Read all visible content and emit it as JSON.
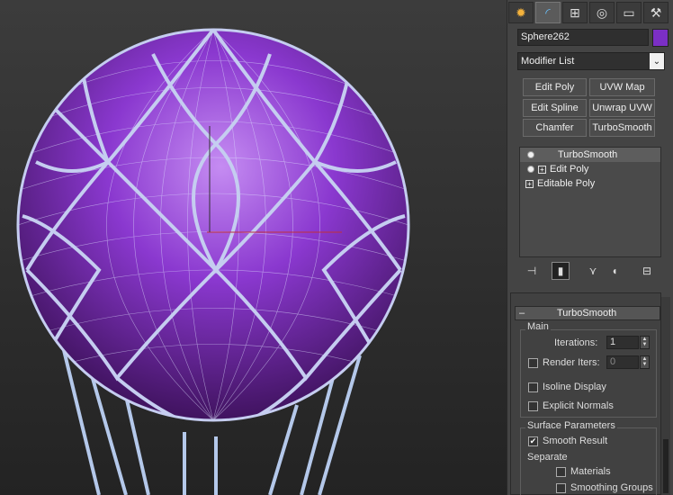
{
  "viewport": {
    "object_color": "#7b2fc5",
    "wire_color": "#c5cdf0",
    "net_color": "#b4c8ea"
  },
  "panel": {
    "tabs": [
      {
        "name": "create-tab",
        "icon": "sun-icon",
        "glyph": "✹"
      },
      {
        "name": "modify-tab",
        "icon": "modify-curve-icon",
        "glyph": "◜"
      },
      {
        "name": "hierarchy-tab",
        "icon": "hierarchy-icon",
        "glyph": "⊞"
      },
      {
        "name": "motion-tab",
        "icon": "motion-icon",
        "glyph": "◎"
      },
      {
        "name": "display-tab",
        "icon": "display-icon",
        "glyph": "▭"
      },
      {
        "name": "utilities-tab",
        "icon": "hammer-icon",
        "glyph": "⚒"
      }
    ],
    "object_name": "Sphere262",
    "object_color": "#7b2fc5",
    "modifier_list": "Modifier List",
    "buttons": [
      "Edit Poly",
      "UVW Map",
      "Edit Spline",
      "Unwrap UVW",
      "Chamfer",
      "TurboSmooth"
    ],
    "stack": [
      "TurboSmooth",
      "Edit Poly",
      "Editable Poly"
    ],
    "rollout": {
      "title": "TurboSmooth",
      "collapse": "–",
      "main_label": "Main",
      "iterations_label": "Iterations:",
      "iterations_value": "1",
      "render_iters_label": "Render Iters:",
      "render_iters_value": "0",
      "isoline_label": "Isoline Display",
      "explicit_normals_label": "Explicit Normals",
      "surface_label": "Surface Parameters",
      "smooth_result_label": "Smooth Result",
      "separate_label": "Separate",
      "materials_label": "Materials",
      "smoothing_groups_label": "Smoothing Groups",
      "check_glyph": "✔"
    }
  }
}
